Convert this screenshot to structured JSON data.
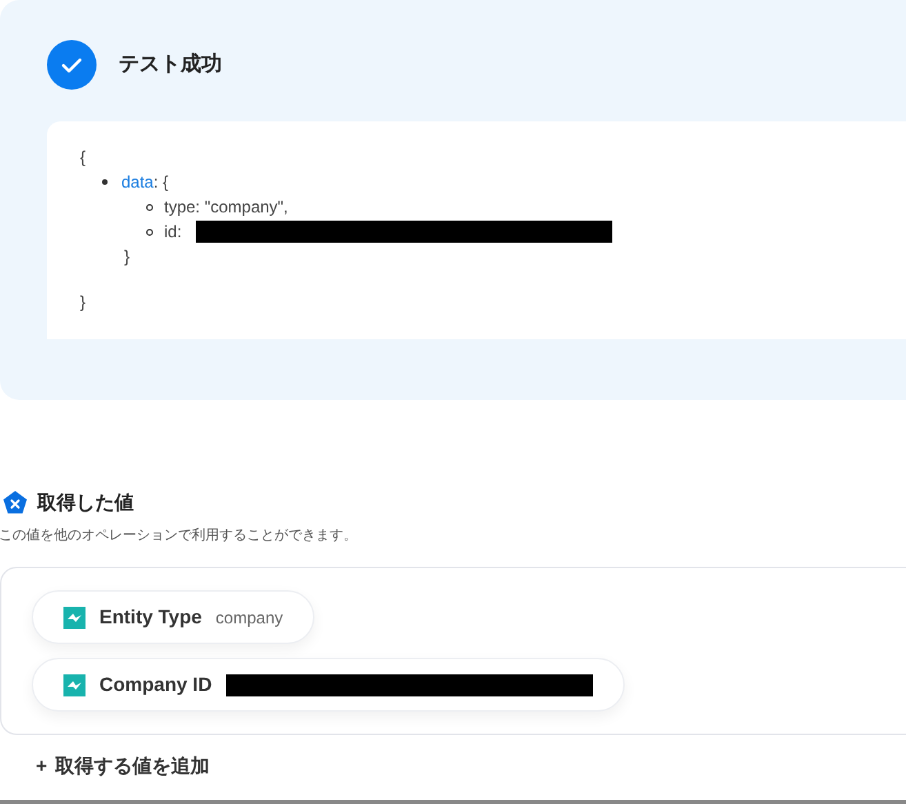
{
  "test_result": {
    "title": "テスト成功",
    "success": true,
    "output": {
      "open": "{",
      "close": "}",
      "items": [
        {
          "key": "data",
          "suffix": ": {",
          "close": "}",
          "children": [
            {
              "text": "type: \"company\","
            },
            {
              "text": "id:",
              "redacted": true
            }
          ]
        }
      ]
    }
  },
  "fetched_values": {
    "title": "取得した値",
    "description": "この値を他のオペレーションで利用することができます。",
    "fields": [
      {
        "label": "Entity Type",
        "value": "company"
      },
      {
        "label": "Company ID",
        "redacted": true
      }
    ],
    "add_button": {
      "icon": "+",
      "label": "取得する値を追加"
    }
  }
}
